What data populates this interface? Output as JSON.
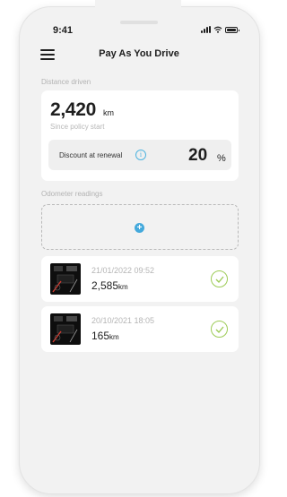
{
  "status_bar": {
    "time": "9:41"
  },
  "header": {
    "title": "Pay As You Drive"
  },
  "distance": {
    "section_label": "Distance driven",
    "value": "2,420",
    "unit": "km",
    "caption": "Since policy start",
    "discount_label": "Discount at renewal",
    "discount_value": "20",
    "discount_unit": "%"
  },
  "odometer": {
    "section_label": "Odometer readings",
    "readings": [
      {
        "date": "21/01/2022 09:52",
        "value": "2,585",
        "unit": "km"
      },
      {
        "date": "20/10/2021 18:05",
        "value": "165",
        "unit": "km"
      }
    ]
  },
  "colors": {
    "accent": "#44a9dc",
    "check": "#9ccb55",
    "background": "#f2f2f2"
  },
  "icons": [
    "menu-icon",
    "info-icon",
    "plus-icon",
    "check-icon",
    "signal-icon",
    "wifi-icon",
    "battery-icon"
  ]
}
